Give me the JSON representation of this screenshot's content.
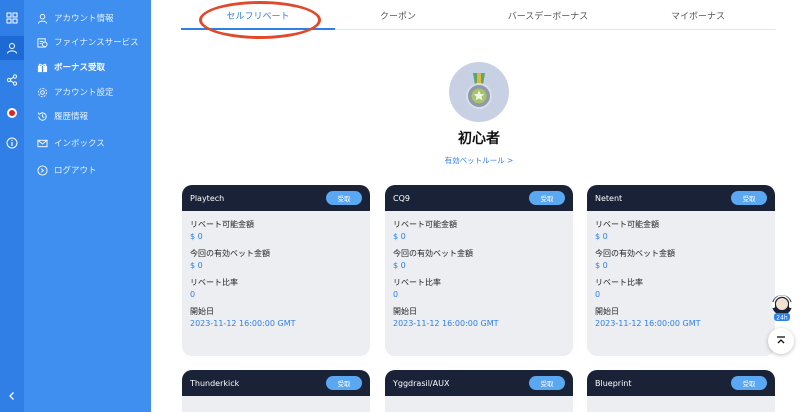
{
  "menu": {
    "items": [
      {
        "label": "アカウント情報",
        "icon": "user-icon"
      },
      {
        "label": "ファイナンスサービス",
        "icon": "finance-icon"
      },
      {
        "label": "ボーナス受取",
        "icon": "gift-icon",
        "active": true
      },
      {
        "label": "アカウント設定",
        "icon": "gear-icon"
      },
      {
        "label": "履歴情報",
        "icon": "history-icon"
      },
      {
        "label": "インボックス",
        "icon": "mail-icon"
      },
      {
        "label": "ログアウト",
        "icon": "logout-icon"
      }
    ]
  },
  "tabs": [
    {
      "label": "セルフリベート",
      "active": true
    },
    {
      "label": "クーポン"
    },
    {
      "label": "バースデーボーナス"
    },
    {
      "label": "マイボーナス"
    }
  ],
  "level": {
    "title": "初心者",
    "rule_link": "有効ベットルール >"
  },
  "card_labels": {
    "claim": "受取",
    "rebate_amount": "リベート可能金額",
    "bet_amount": "今回の有効ベット金額",
    "rebate_rate": "リベート比率",
    "start_date": "開始日"
  },
  "cards": [
    {
      "name": "Playtech",
      "rebate_amount": "$ 0",
      "bet_amount": "$ 0",
      "rebate_rate": "0",
      "start_date": "2023-11-12 16:00:00 GMT"
    },
    {
      "name": "CQ9",
      "rebate_amount": "$ 0",
      "bet_amount": "$ 0",
      "rebate_rate": "0",
      "start_date": "2023-11-12 16:00:00 GMT"
    },
    {
      "name": "Netent",
      "rebate_amount": "$ 0",
      "bet_amount": "$ 0",
      "rebate_rate": "0",
      "start_date": "2023-11-12 16:00:00 GMT"
    },
    {
      "name": "Thunderkick",
      "rebate_amount": "",
      "bet_amount": "",
      "rebate_rate": "",
      "start_date": ""
    },
    {
      "name": "Yggdrasil/AUX",
      "rebate_amount": "",
      "bet_amount": "",
      "rebate_rate": "",
      "start_date": ""
    },
    {
      "name": "Blueprint",
      "rebate_amount": "",
      "bet_amount": "",
      "rebate_rate": "",
      "start_date": ""
    }
  ],
  "colors": {
    "primary": "#2f7fe6",
    "menu_bg": "#3f8ff0",
    "card_header": "#1a2238",
    "highlight": "#e0492b"
  }
}
